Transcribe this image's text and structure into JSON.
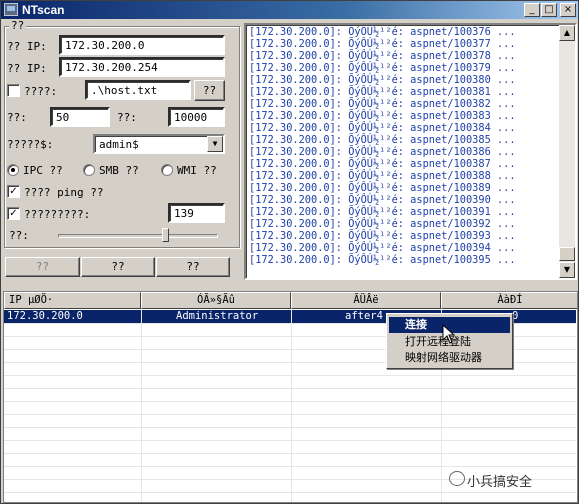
{
  "window": {
    "title": "NTscan",
    "minimize": "_",
    "maximize": "□",
    "close": "×"
  },
  "options": {
    "group_label": "??",
    "ip_start_label": "?? IP:",
    "ip_start_value": "172.30.200.0",
    "ip_end_label": "?? IP:",
    "ip_end_value": "172.30.200.254",
    "hostfile_label": "????:",
    "hostfile_value": ".\\host.txt",
    "hostfile_button": "??",
    "left_num_label": "??:",
    "left_num_value": "50",
    "right_num_label": "??:",
    "right_num_value": "10000",
    "share_label": "?????$:",
    "share_value": "admin$",
    "radio_ipc": "IPC ??",
    "radio_smb": "SMB ??",
    "radio_wmi": "WMI ??",
    "ping_label": "???? ping ??",
    "ping_checked": true,
    "port_label": "?????????:",
    "port_checked": true,
    "port_value": "139",
    "slider_label": "??:",
    "slider_level": 0.68,
    "hostfile_checked": false
  },
  "actions": {
    "button1": "??",
    "button2": "??",
    "button3": "??"
  },
  "log": {
    "lines": [
      "[172.30.200.0]: ÕýÔÚ½¹²é: aspnet/100376 ...",
      "[172.30.200.0]: ÕýÔÚ½¹²é: aspnet/100377 ...",
      "[172.30.200.0]: ÕýÔÚ½¹²é: aspnet/100378 ...",
      "[172.30.200.0]: ÕýÔÚ½¹²é: aspnet/100379 ...",
      "[172.30.200.0]: ÕýÔÚ½¹²é: aspnet/100380 ...",
      "[172.30.200.0]: ÕýÔÚ½¹²é: aspnet/100381 ...",
      "[172.30.200.0]: ÕýÔÚ½¹²é: aspnet/100382 ...",
      "[172.30.200.0]: ÕýÔÚ½¹²é: aspnet/100383 ...",
      "[172.30.200.0]: ÕýÔÚ½¹²é: aspnet/100384 ...",
      "[172.30.200.0]: ÕýÔÚ½¹²é: aspnet/100385 ...",
      "[172.30.200.0]: ÕýÔÚ½¹²é: aspnet/100386 ...",
      "[172.30.200.0]: ÕýÔÚ½¹²é: aspnet/100387 ...",
      "[172.30.200.0]: ÕýÔÚ½¹²é: aspnet/100388 ...",
      "[172.30.200.0]: ÕýÔÚ½¹²é: aspnet/100389 ...",
      "[172.30.200.0]: ÕýÔÚ½¹²é: aspnet/100390 ...",
      "[172.30.200.0]: ÕýÔÚ½¹²é: aspnet/100391 ...",
      "[172.30.200.0]: ÕýÔÚ½¹²é: aspnet/100392 ...",
      "[172.30.200.0]: ÕýÔÚ½¹²é: aspnet/100393 ...",
      "[172.30.200.0]: ÕýÔÚ½¹²é: aspnet/100394 ...",
      "[172.30.200.0]: ÕýÔÚ½¹²é: aspnet/100395 ..."
    ]
  },
  "results": {
    "columns": [
      "IP µØÖ·",
      "ÓÃ»§Ãû",
      "ÃÜÂë",
      "ÀàÐÍ"
    ],
    "row": {
      "ip": "172.30.200.0",
      "user": "Administrator",
      "password": "after4",
      "type": "0"
    }
  },
  "context_menu": {
    "items": [
      "连接",
      "打开远程登陆",
      "映射网络驱动器"
    ]
  },
  "watermark": {
    "text": "小兵搞安全"
  },
  "colors": {
    "title_start": "#0a246a",
    "title_end": "#a6caf0",
    "log_text": "#1f3fa8",
    "selection": "#0a246a",
    "face": "#d4d0c8"
  }
}
